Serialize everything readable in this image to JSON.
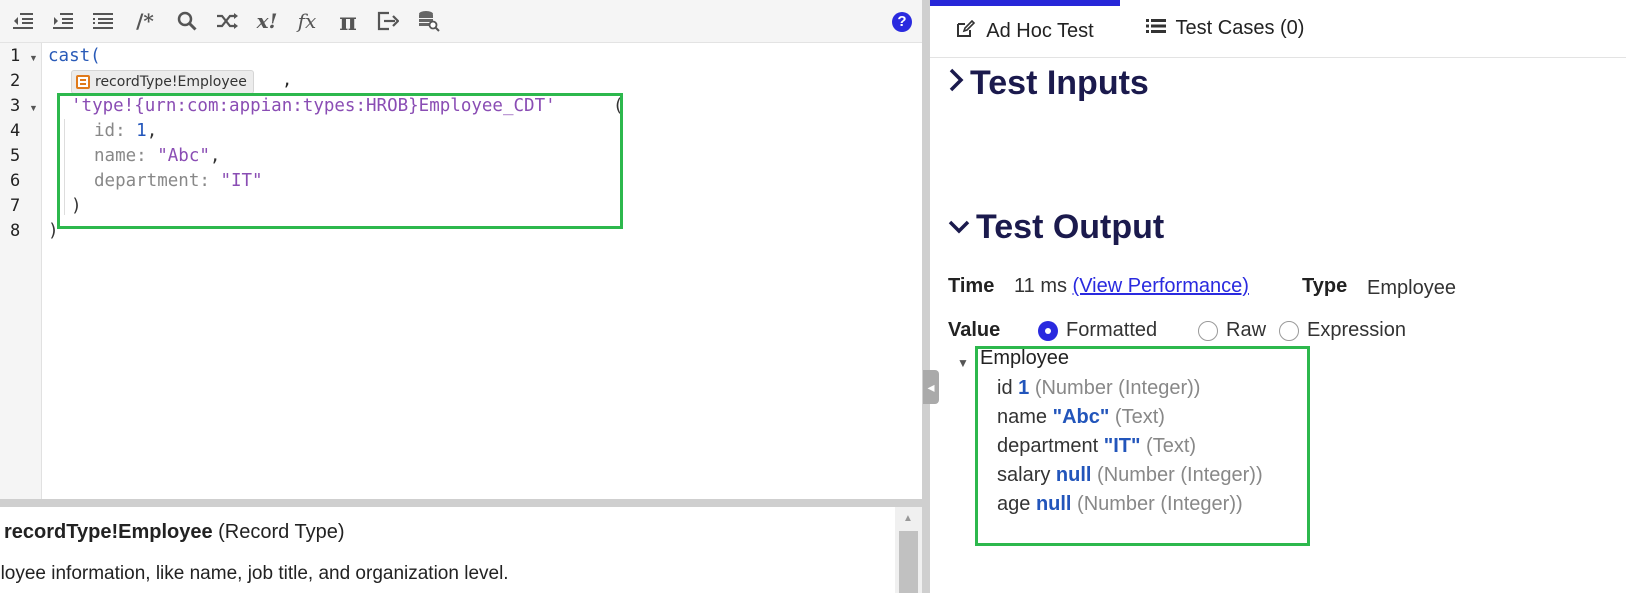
{
  "toolbar": {
    "icons": [
      "outdent-icon",
      "indent-icon",
      "format-list-icon",
      "comment-icon",
      "search-icon",
      "shuffle-icon",
      "x-factorial-icon",
      "function-icon",
      "pi-icon",
      "export-icon",
      "database-search-icon",
      "help-icon"
    ],
    "comment_label": "/*",
    "x_label": "x!",
    "fx_label": "fx",
    "pi_label": "π",
    "help_label": "?"
  },
  "editor": {
    "line_numbers": [
      "1",
      "2",
      "3",
      "4",
      "5",
      "6",
      "7",
      "8"
    ],
    "line1": "cast(",
    "chip_label": "recordType!Employee",
    "chip_comma": ",",
    "line3_str": "'type!{urn:com:appian:types:HROB}Employee_CDT'",
    "line3_paren": "(",
    "line4_key": "id: ",
    "line4_val": "1",
    "line4_comma": ",",
    "line5_key": "name: ",
    "line5_val": "\"Abc\"",
    "line5_comma": ",",
    "line6_key": "department: ",
    "line6_val": "\"IT\"",
    "line7": ")",
    "line8": ")"
  },
  "doc": {
    "title_bold": "recordType!Employee",
    "title_type": " (Record Type)",
    "description": "ployee information, like name, job title, and organization level."
  },
  "tabs": [
    {
      "label": "Ad Hoc Test",
      "icon": "edit-icon",
      "active": true
    },
    {
      "label": "Test Cases (0)",
      "icon": "list-icon",
      "active": false
    }
  ],
  "test_inputs": {
    "title": "Test Inputs"
  },
  "test_output": {
    "title": "Test Output",
    "time_label": "Time",
    "time_value": "11 ms",
    "view_performance": "(View Performance)",
    "type_label": "Type",
    "type_value": "Employee",
    "value_label": "Value",
    "options": [
      {
        "label": "Formatted",
        "selected": true
      },
      {
        "label": "Raw",
        "selected": false
      },
      {
        "label": "Expression",
        "selected": false
      }
    ],
    "tree": {
      "root": "Employee",
      "fields": [
        {
          "name": "id",
          "value": "1",
          "type": "(Number (Integer))"
        },
        {
          "name": "name",
          "value": "\"Abc\"",
          "type": "(Text)"
        },
        {
          "name": "department",
          "value": "\"IT\"",
          "type": "(Text)"
        },
        {
          "name": "salary",
          "value": "null",
          "type": "(Number (Integer))"
        },
        {
          "name": "age",
          "value": "null",
          "type": "(Number (Integer))"
        }
      ]
    }
  },
  "colors": {
    "accent": "#2a2adf",
    "highlight": "#2db84d",
    "heading": "#1b1a4d",
    "value_blue": "#2255bb",
    "string_purple": "#8a4db4"
  }
}
